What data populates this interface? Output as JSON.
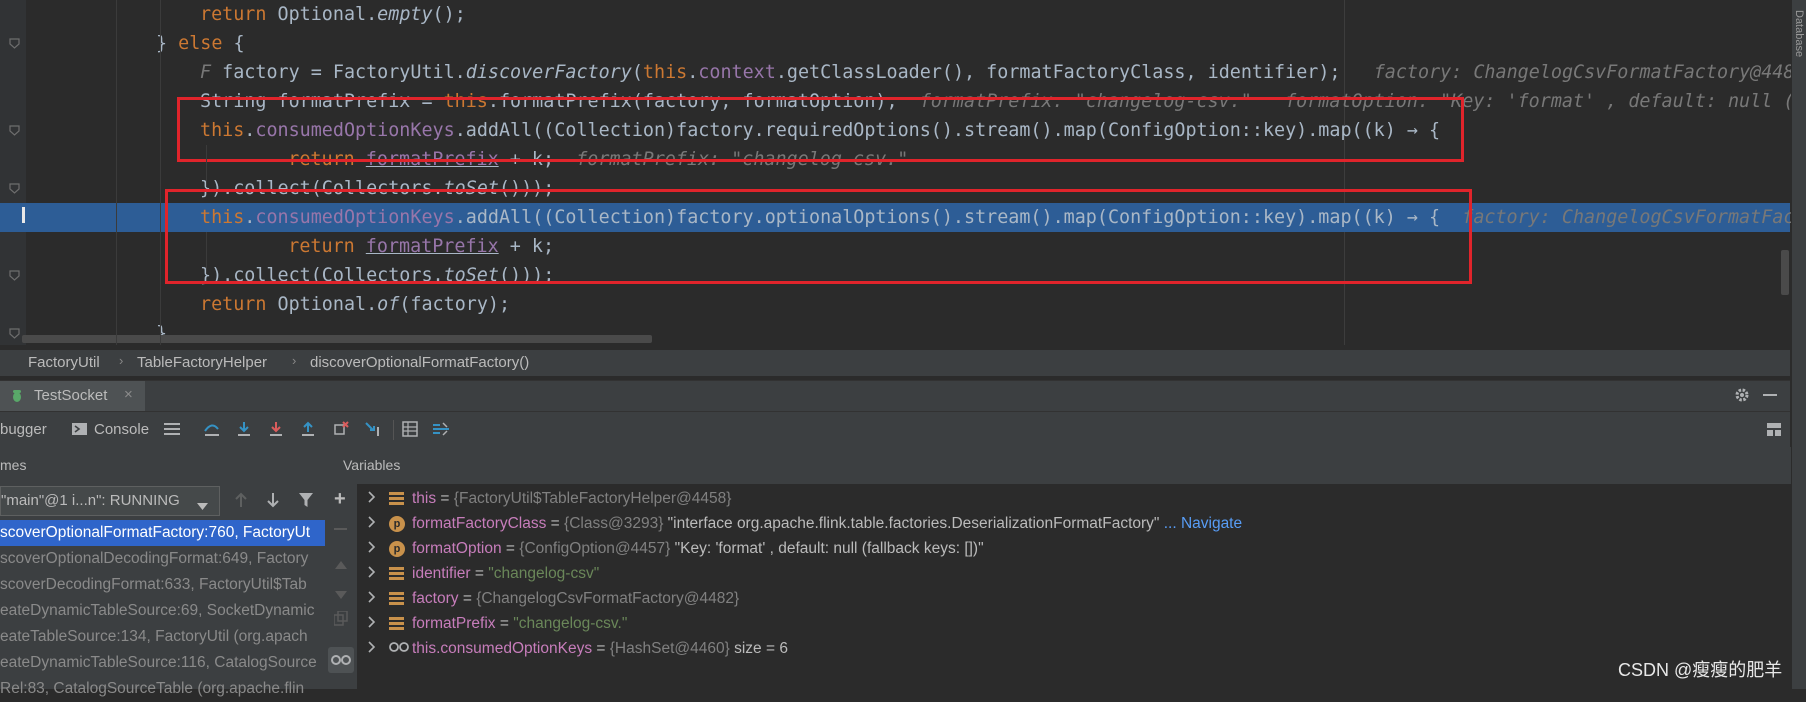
{
  "editor": {
    "lines": [
      {
        "segments": [
          {
            "t": "return ",
            "c": "kw"
          },
          {
            "t": "Optional."
          },
          {
            "t": "empty",
            "c": "it"
          },
          {
            "t": "();"
          }
        ]
      },
      {
        "segments": [
          {
            "t": "} "
          },
          {
            "t": "else",
            "c": "kw"
          },
          {
            "t": " {"
          }
        ]
      },
      {
        "segments": [
          {
            "t": "F",
            "c": "hint"
          },
          {
            "t": " factory = FactoryUtil."
          },
          {
            "t": "discoverFactory",
            "c": "it"
          },
          {
            "t": "("
          },
          {
            "t": "this",
            "c": "kw"
          },
          {
            "t": "."
          },
          {
            "t": "context",
            "c": "fld"
          },
          {
            "t": ".getClassLoader(), formatFactoryClass, identifier);"
          },
          {
            "t": "   factory: ChangelogCsvFormatFactory@4482",
            "c": "hint"
          }
        ]
      },
      {
        "segments": [
          {
            "t": "String formatPrefix = "
          },
          {
            "t": "this",
            "c": "kw"
          },
          {
            "t": ".formatPrefix(factory, formatOption);"
          },
          {
            "t": "  formatPrefix: \"changelog-csv.\"   formatOption: \"Key: 'format' , default: null (",
            "c": "hint"
          }
        ]
      },
      {
        "segments": [
          {
            "t": "this",
            "c": "kw"
          },
          {
            "t": "."
          },
          {
            "t": "consumedOptionKeys",
            "c": "fld"
          },
          {
            "t": ".addAll((Collection)factory.requiredOptions().stream().map(ConfigOption::key).map((k) → {"
          }
        ]
      },
      {
        "segments": [
          {
            "t": "    return ",
            "c": "kw"
          },
          {
            "t": "formatPrefix",
            "c": "fld ul"
          },
          {
            "t": " + k;"
          },
          {
            "t": "  formatPrefix: \"changelog-csv.\"",
            "c": "hint"
          }
        ]
      },
      {
        "segments": [
          {
            "t": "}).collect(Collectors."
          },
          {
            "t": "toSet",
            "c": "it"
          },
          {
            "t": "()));"
          }
        ]
      },
      {
        "segments": [
          {
            "t": "this",
            "c": "kw"
          },
          {
            "t": "."
          },
          {
            "t": "consumedOptionKeys",
            "c": "fld"
          },
          {
            "t": ".addAll((Collection)factory.optionalOptions().stream().map(ConfigOption::key).map((k) → {"
          },
          {
            "t": "  factory: ChangelogCsvFormatFac",
            "c": "hint"
          }
        ]
      },
      {
        "segments": [
          {
            "t": "    return ",
            "c": "kw"
          },
          {
            "t": "formatPrefix",
            "c": "fld ul"
          },
          {
            "t": " + k;"
          }
        ]
      },
      {
        "segments": [
          {
            "t": "}).collect(Collectors."
          },
          {
            "t": "toSet",
            "c": "it"
          },
          {
            "t": "()));"
          }
        ]
      },
      {
        "segments": [
          {
            "t": "return ",
            "c": "kw"
          },
          {
            "t": "Optional."
          },
          {
            "t": "of",
            "c": "it"
          },
          {
            "t": "(factory);"
          }
        ]
      },
      {
        "segments": [
          {
            "t": "}"
          }
        ]
      }
    ]
  },
  "breadcrumb": [
    "FactoryUtil",
    "TableFactoryHelper",
    "discoverOptionalFormatFactory()"
  ],
  "run_tab": {
    "label": "TestSocket"
  },
  "toolbar": {
    "debugger_label": "bugger",
    "console_label": "Console"
  },
  "frames": {
    "title": "mes",
    "thread": "\"main\"@1 i...n\": RUNNING",
    "items": [
      "scoverOptionalFormatFactory:760, FactoryUt",
      "scoverOptionalDecodingFormat:649, Factory",
      "scoverDecodingFormat:633, FactoryUtil$Tab",
      "eateDynamicTableSource:69, SocketDynamic",
      "eateTableSource:134, FactoryUtil (org.apach",
      "eateDynamicTableSource:116, CatalogSource",
      "Rel:83, CatalogSourceTable (org.apache.flin"
    ]
  },
  "variables": {
    "title": "Variables",
    "items": [
      {
        "icon": "field",
        "name": "this",
        "eq": " = ",
        "ref": "{FactoryUtil$TableFactoryHelper@4458}",
        "val": "",
        "link": ""
      },
      {
        "icon": "param",
        "name": "formatFactoryClass",
        "eq": " = ",
        "ref": "{Class@3293}",
        "val": " \"interface org.apache.flink.table.factories.DeserializationFormatFactory\"",
        "link": " ... Navigate"
      },
      {
        "icon": "param",
        "name": "formatOption",
        "eq": " = ",
        "ref": "{ConfigOption@4457}",
        "val": " \"Key: 'format' , default: null (fallback keys: [])\"",
        "link": ""
      },
      {
        "icon": "field",
        "name": "identifier",
        "eq": " = ",
        "ref": "",
        "val": "\"changelog-csv\"",
        "link": ""
      },
      {
        "icon": "field",
        "name": "factory",
        "eq": " = ",
        "ref": "{ChangelogCsvFormatFactory@4482}",
        "val": "",
        "link": ""
      },
      {
        "icon": "field",
        "name": "formatPrefix",
        "eq": " = ",
        "ref": "",
        "val": "\"changelog-csv.\"",
        "link": ""
      },
      {
        "icon": "watch",
        "name": "this.consumedOptionKeys",
        "eq": " = ",
        "ref": "{HashSet@4460}",
        "val": "  size = 6",
        "link": ""
      }
    ]
  },
  "side_strip": "Database",
  "watermark": "CSDN @瘦瘦的肥羊",
  "colors": {
    "keyword": "#cc7832",
    "field": "#9876aa",
    "string": "#6a8759",
    "selection": "#2f65ca",
    "exec_line": "#2d5d96",
    "highlight_box": "#e0242b"
  }
}
